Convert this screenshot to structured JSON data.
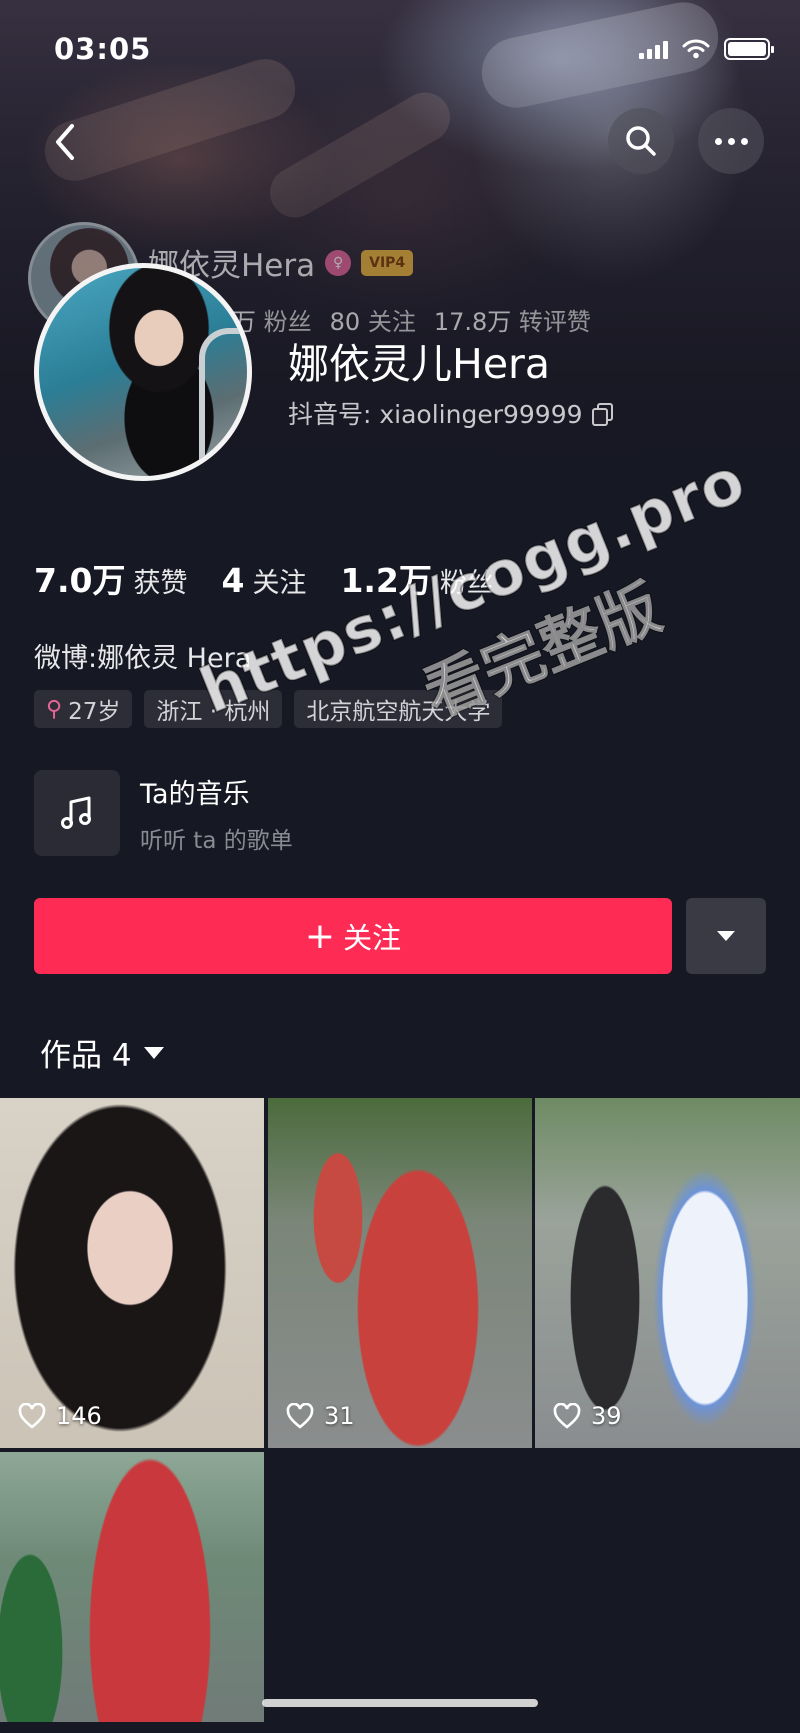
{
  "status_bar": {
    "time": "03:05"
  },
  "ghost_header": {
    "name": "娜依灵Hera",
    "vip": "VIP4",
    "stats": [
      {
        "num": "万",
        "label": "粉丝"
      },
      {
        "num": "80",
        "label": "关注"
      },
      {
        "num": "17.8万",
        "label": "转评赞"
      }
    ]
  },
  "profile": {
    "display_name": "娜依灵儿Hera",
    "douyin_id": "抖音号: xiaolinger99999",
    "stats": [
      {
        "num": "7.0万",
        "label": "获赞"
      },
      {
        "num": "4",
        "label": "关注"
      },
      {
        "num": "1.2万",
        "label": "粉丝"
      }
    ],
    "weibo": "微博:娜依灵 Hera",
    "tags": [
      {
        "text": "27岁",
        "icon": "female-icon"
      },
      {
        "text": "浙江 · 杭州"
      },
      {
        "text": "北京航空航天大学"
      }
    ],
    "music": {
      "title": "Ta的音乐",
      "subtitle": "听听 ta 的歌单",
      "icon": "music-note-icon"
    },
    "follow_label": "关注",
    "follow_plus": "+"
  },
  "works": {
    "label": "作品 4",
    "items": [
      {
        "likes": "146"
      },
      {
        "likes": "31"
      },
      {
        "likes": "39"
      },
      {
        "likes": ""
      }
    ]
  },
  "watermark": {
    "url": "https://cogg.pro",
    "text": "看完整版"
  },
  "colors": {
    "background": "#161823",
    "accent": "#fe2c55",
    "tag_bg": "#2c2d37"
  }
}
